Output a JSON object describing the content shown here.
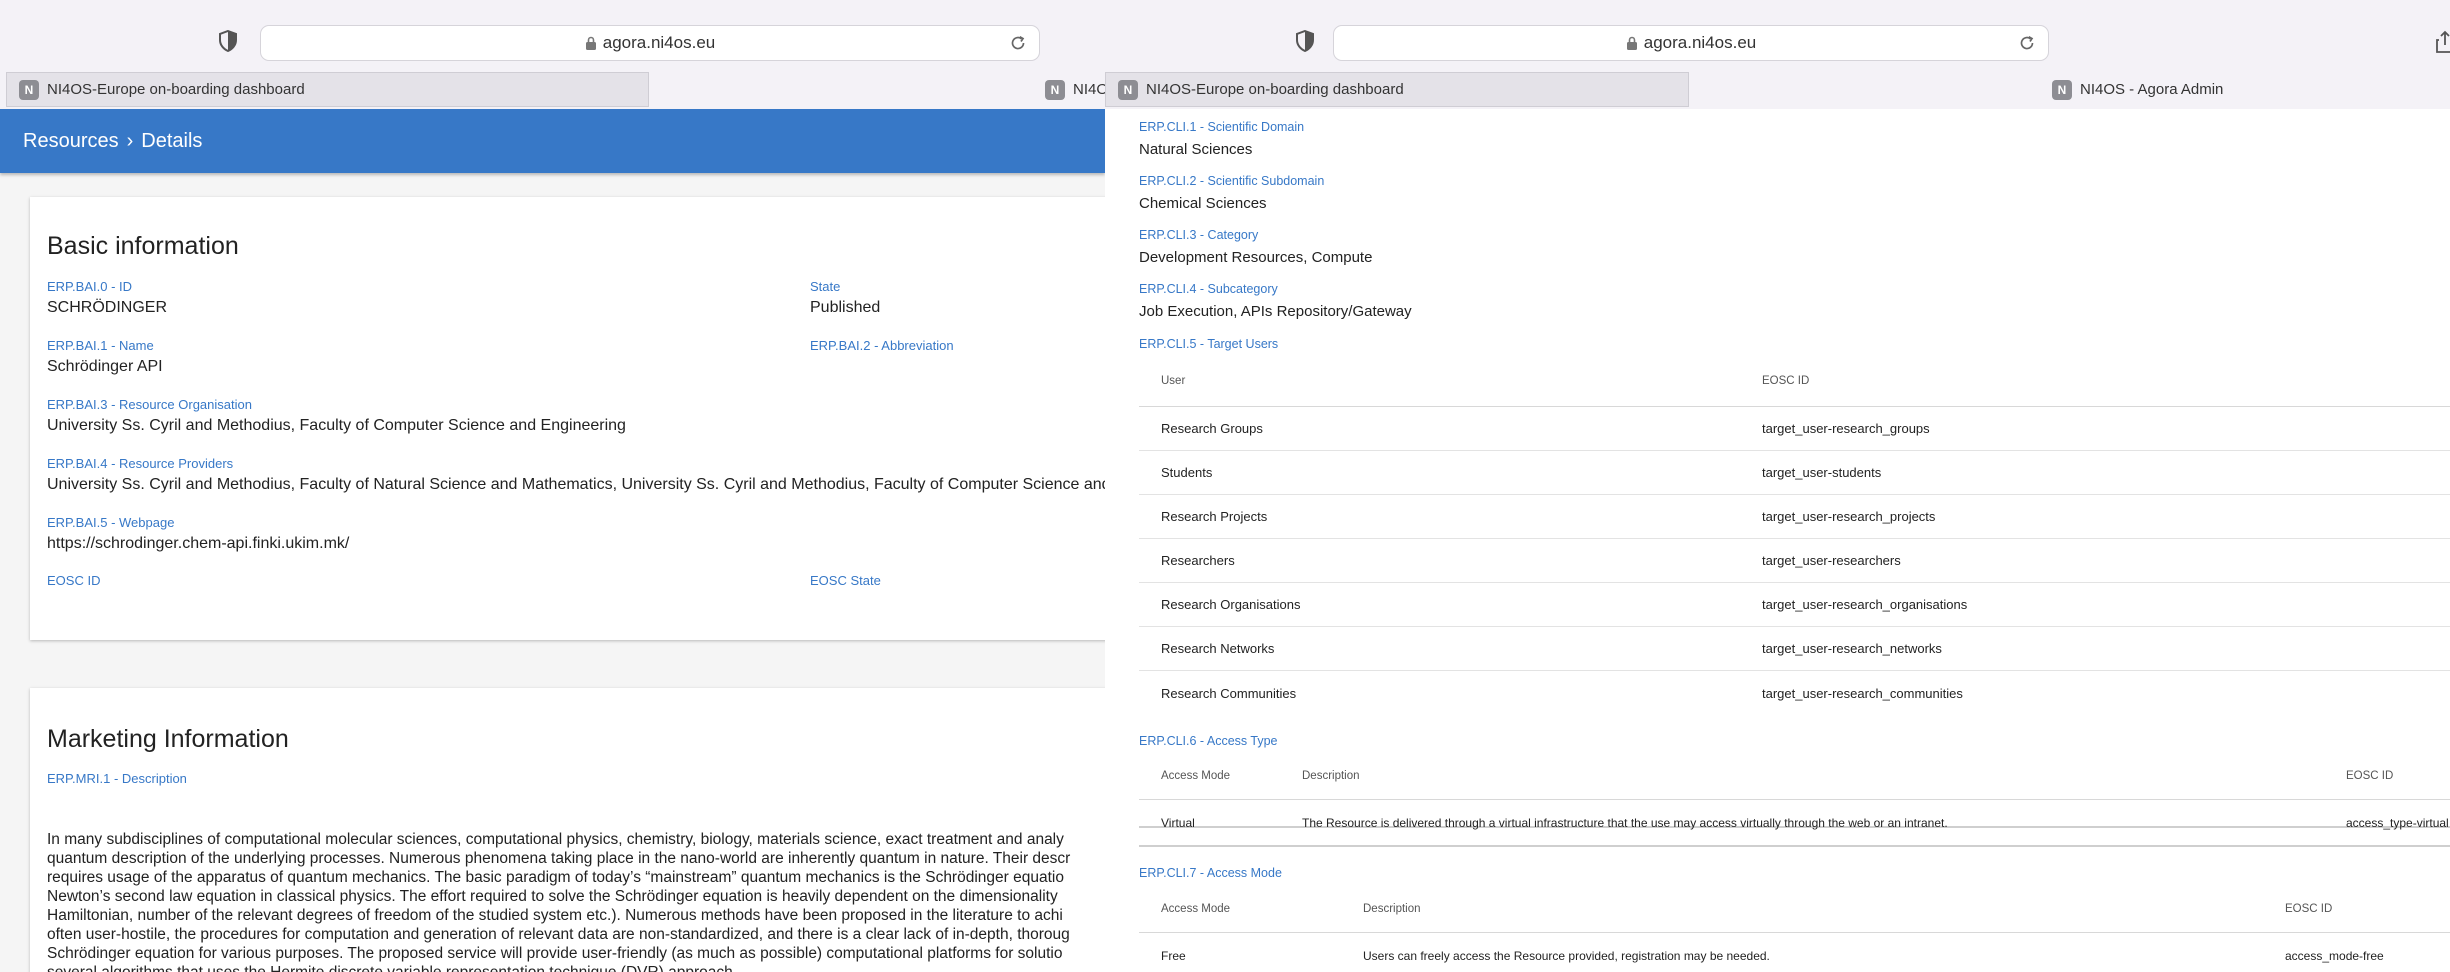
{
  "browser_left": {
    "url": "agora.ni4os.eu",
    "tabs": [
      {
        "label": "NI4OS-Europe on-boarding dashboard",
        "favicon": "N"
      },
      {
        "label": "NI4O",
        "favicon": "N"
      }
    ]
  },
  "browser_right": {
    "url": "agora.ni4os.eu",
    "tabs": [
      {
        "label": "NI4OS-Europe on-boarding dashboard",
        "favicon": "N"
      },
      {
        "label": "NI4OS - Agora Admin",
        "favicon": "N"
      }
    ]
  },
  "header": {
    "breadcrumb_root": "Resources",
    "breadcrumb_sep": "›",
    "breadcrumb_current": "Details",
    "accent_color": "#3778c7"
  },
  "basic_info": {
    "title": "Basic information",
    "id_label": "ERP.BAI.0 - ID",
    "id_value": "SCHRÖDINGER",
    "state_label": "State",
    "state_value": "Published",
    "name_label": "ERP.BAI.1 - Name",
    "name_value": "Schrödinger API",
    "abbrev_label": "ERP.BAI.2 - Abbreviation",
    "org_label": "ERP.BAI.3 - Resource Organisation",
    "org_value": "University Ss. Cyril and Methodius, Faculty of Computer Science and Engineering",
    "providers_label": "ERP.BAI.4 - Resource Providers",
    "providers_value": "University Ss. Cyril and Methodius, Faculty of Natural Science and Mathematics, University Ss. Cyril and Methodius, Faculty of Computer Science and",
    "webpage_label": "ERP.BAI.5 - Webpage",
    "webpage_value": "https://schrodinger.chem-api.finki.ukim.mk/",
    "eosc_id_label": "EOSC ID",
    "eosc_state_label": "EOSC State"
  },
  "marketing": {
    "title": "Marketing Information",
    "desc_label": "ERP.MRI.1 - Description",
    "desc_lines": [
      "In many subdisciplines of computational molecular sciences, computational physics, chemistry, biology, materials science, exact treatment and analy",
      "quantum description of the underlying processes. Numerous phenomena taking place in the nano-world are inherently quantum in nature. Their descr",
      "requires usage of the apparatus of quantum mechanics. The basic paradigm of today’s “mainstream” quantum mechanics is the Schrödinger equatio",
      "Newton’s second law equation in classical physics.  The effort required to solve the Schrödinger equation is heavily dependent on the dimensionality",
      "Hamiltonian, number of the relevant degrees of freedom of the studied system etc.). Numerous methods have been proposed in the literature to achi",
      "often user-hostile, the procedures for computation and generation of relevant data are non-standardized, and there is a clear lack of in-depth, thoroug",
      "Schrödinger equation for various purposes. The proposed service will provide user-friendly (as much as possible) computational platforms for solutio",
      "several algorithms that uses the Hermite discrete variable representation technique (DVR) approach."
    ]
  },
  "classification": {
    "domain_label": "ERP.CLI.1 - Scientific Domain",
    "domain_value": "Natural Sciences",
    "subdomain_label": "ERP.CLI.2 - Scientific Subdomain",
    "subdomain_value": "Chemical Sciences",
    "category_label": "ERP.CLI.3 - Category",
    "category_value": "Development Resources, Compute",
    "subcategory_label": "ERP.CLI.4 - Subcategory",
    "subcategory_value": "Job Execution, APIs Repository/Gateway",
    "target_users_label": "ERP.CLI.5 - Target Users",
    "target_users": {
      "columns": [
        "User",
        "EOSC ID"
      ],
      "rows": [
        [
          "Research Groups",
          "target_user-research_groups"
        ],
        [
          "Students",
          "target_user-students"
        ],
        [
          "Research Projects",
          "target_user-research_projects"
        ],
        [
          "Researchers",
          "target_user-researchers"
        ],
        [
          "Research Organisations",
          "target_user-research_organisations"
        ],
        [
          "Research Networks",
          "target_user-research_networks"
        ],
        [
          "Research Communities",
          "target_user-research_communities"
        ]
      ]
    },
    "access_type_label": "ERP.CLI.6 - Access Type",
    "access_type": {
      "columns": [
        "Access Mode",
        "Description",
        "EOSC ID"
      ],
      "rows": [
        [
          "Virtual",
          "The Resource is delivered through a virtual infrastructure that the use may access virtually through the web or an intranet.",
          "access_type-virtual"
        ]
      ]
    },
    "access_mode_label": "ERP.CLI.7 - Access Mode",
    "access_mode": {
      "columns": [
        "Access Mode",
        "Description",
        "EOSC ID"
      ],
      "rows": [
        [
          "Free",
          "Users can freely access the Resource provided, registration may be needed.",
          "access_mode-free"
        ]
      ]
    }
  }
}
